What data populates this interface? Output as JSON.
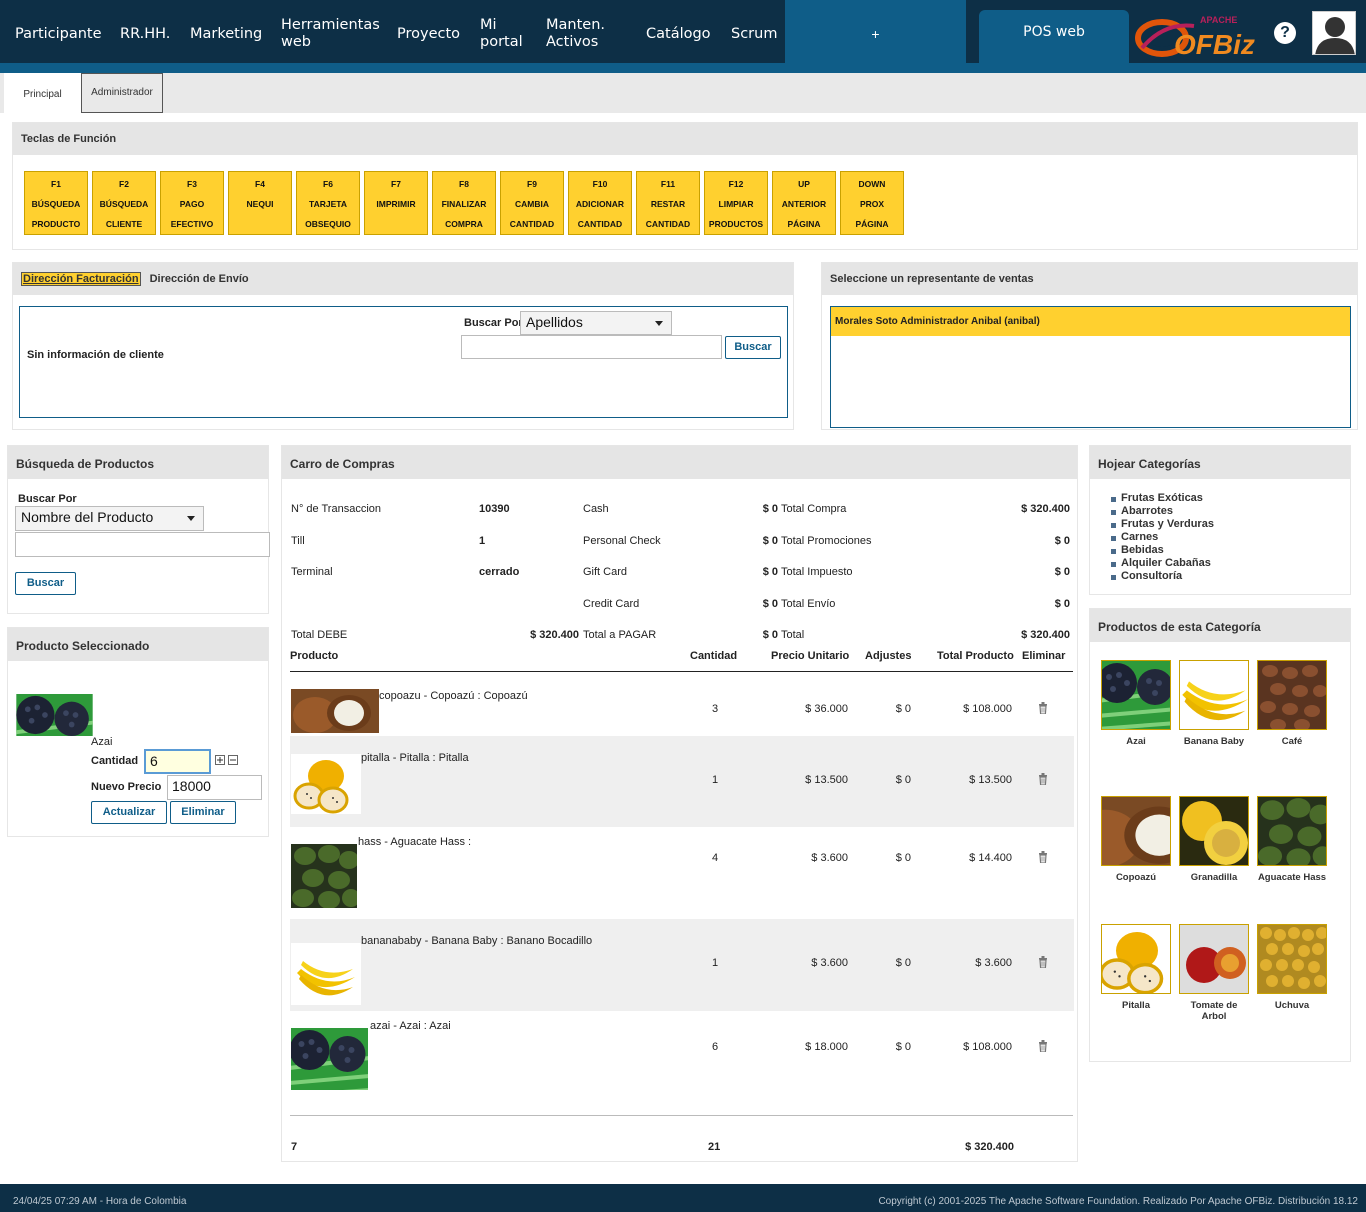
{
  "nav": {
    "items": [
      "Participante",
      "RR.HH.",
      "Marketing",
      "Herramientas web",
      "Proyecto",
      "Mi portal",
      "Manten. Activos",
      "Catálogo",
      "Scrum"
    ],
    "plus": "+",
    "pos": "POS web",
    "help": "?"
  },
  "logo": {
    "apache": "APACHE",
    "name": "OFBiz"
  },
  "subtabs": [
    "Principal",
    "Administrador"
  ],
  "function_keys": {
    "title": "Teclas de Función",
    "keys": [
      {
        "key": "F1",
        "l1": "BÚSQUEDA",
        "l2": "PRODUCTO"
      },
      {
        "key": "F2",
        "l1": "BÚSQUEDA",
        "l2": "CLIENTE"
      },
      {
        "key": "F3",
        "l1": "PAGO",
        "l2": "EFECTIVO"
      },
      {
        "key": "F4",
        "l1": "NEQUI",
        "l2": ""
      },
      {
        "key": "F6",
        "l1": "TARJETA",
        "l2": "OBSEQUIO"
      },
      {
        "key": "F7",
        "l1": "IMPRIMIR",
        "l2": ""
      },
      {
        "key": "F8",
        "l1": "FINALIZAR",
        "l2": "COMPRA"
      },
      {
        "key": "F9",
        "l1": "CAMBIA",
        "l2": "CANTIDAD"
      },
      {
        "key": "F10",
        "l1": "ADICIONAR",
        "l2": "CANTIDAD"
      },
      {
        "key": "F11",
        "l1": "RESTAR",
        "l2": "CANTIDAD"
      },
      {
        "key": "F12",
        "l1": "LIMPIAR",
        "l2": "PRODUCTOS"
      },
      {
        "key": "UP",
        "l1": "ANTERIOR",
        "l2": "PÁGINA"
      },
      {
        "key": "DOWN",
        "l1": "PROX",
        "l2": "PÁGINA"
      }
    ]
  },
  "address": {
    "tab_billing": "Dirección Facturación",
    "tab_shipping": "Dirección de Envío",
    "no_customer": "Sin información de cliente",
    "search_by_label": "Buscar Por",
    "search_by_value": "Apellidos",
    "search_button": "Buscar"
  },
  "sales_rep": {
    "title": "Seleccione un representante de ventas",
    "selected": "Morales Soto Administrador Anibal (anibal)"
  },
  "product_search": {
    "title": "Búsqueda de Productos",
    "label": "Buscar Por",
    "select_value": "Nombre del Producto",
    "button": "Buscar"
  },
  "selected_product": {
    "title": "Producto Seleccionado",
    "name": "Azai",
    "qty_label": "Cantidad",
    "qty_value": "6",
    "price_label": "Nuevo Precio",
    "price_value": "18000",
    "update": "Actualizar",
    "delete": "Eliminar"
  },
  "cart": {
    "title": "Carro de Compras",
    "summary": [
      {
        "label": "N° de Transaccion",
        "value": "10390",
        "pay": "Cash",
        "pay_value": "$ 0",
        "tot": "Total Compra",
        "tot_value": "$ 320.400"
      },
      {
        "label": "Till",
        "value": "1",
        "pay": "Personal Check",
        "pay_value": "$ 0",
        "tot": "Total Promociones",
        "tot_value": "$ 0"
      },
      {
        "label": "Terminal",
        "value": "cerrado",
        "pay": "Gift Card",
        "pay_value": "$ 0",
        "tot": "Total Impuesto",
        "tot_value": "$ 0"
      },
      {
        "label": "",
        "value": "",
        "pay": "Credit Card",
        "pay_value": "$ 0",
        "tot": "Total Envío",
        "tot_value": "$ 0"
      },
      {
        "label": "Total DEBE",
        "value": "$ 320.400",
        "pay": "Total a PAGAR",
        "pay_value": "$ 0",
        "tot": "Total",
        "tot_value": "$ 320.400"
      }
    ],
    "headers": {
      "product": "Producto",
      "qty": "Cantidad",
      "unit": "Precio Unitario",
      "adj": "Adjustes",
      "total": "Total Producto",
      "del": "Eliminar"
    },
    "items": [
      {
        "name": "copoazu - Copoazú : Copoazú",
        "qty": "3",
        "unit": "$ 36.000",
        "adj": "$ 0",
        "total": "$ 108.000"
      },
      {
        "name": "pitalla - Pitalla : Pitalla",
        "qty": "1",
        "unit": "$ 13.500",
        "adj": "$ 0",
        "total": "$ 13.500"
      },
      {
        "name": "hass - Aguacate Hass :",
        "qty": "4",
        "unit": "$ 3.600",
        "adj": "$ 0",
        "total": "$ 14.400"
      },
      {
        "name": "bananababy - Banana Baby : Banano Bocadillo",
        "qty": "1",
        "unit": "$ 3.600",
        "adj": "$ 0",
        "total": "$ 3.600"
      },
      {
        "name": "azai - Azai : Azai",
        "qty": "6",
        "unit": "$ 18.000",
        "adj": "$ 0",
        "total": "$ 108.000"
      }
    ],
    "footer": {
      "lines": "7",
      "qty": "21",
      "total": "$ 320.400"
    }
  },
  "categories": {
    "title": "Hojear Categorías",
    "items": [
      "Frutas Exóticas",
      "Abarrotes",
      "Frutas y Verduras",
      "Carnes",
      "Bebidas",
      "Alquiler Cabañas",
      "Consultoría"
    ]
  },
  "category_products": {
    "title": "Productos de esta Categoría",
    "items": [
      "Azai",
      "Banana Baby",
      "Café",
      "Copoazú",
      "Granadilla",
      "Aguacate Hass",
      "Pitalla",
      "Tomate de Arbol",
      "Uchuva"
    ]
  },
  "footer": {
    "left": "24/04/25 07:29 AM - Hora de Colombia",
    "right": "Copyright (c) 2001-2025 The Apache Software Foundation. Realizado Por Apache OFBiz. Distribución 18.12"
  },
  "colors": {
    "navbar": "#0d2f46",
    "accent": "#0f5d88",
    "key_yellow": "#ffd02f"
  }
}
